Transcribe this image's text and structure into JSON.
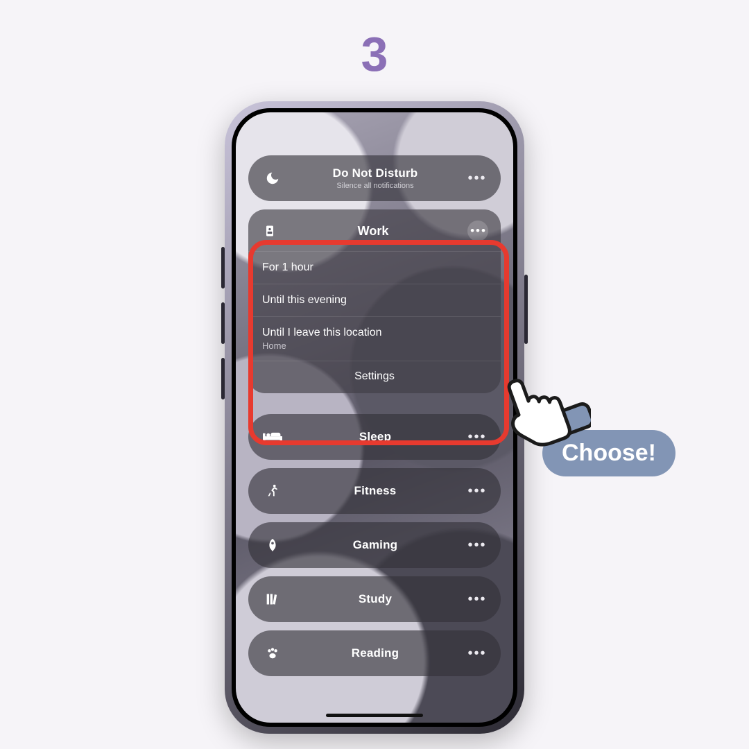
{
  "step_number": "3",
  "callout_label": "Choose!",
  "dnd": {
    "icon": "moon-icon",
    "title": "Do Not Disturb",
    "subtitle": "Silence all notifications",
    "more": "•••"
  },
  "work_card": {
    "icon": "badge-icon",
    "title": "Work",
    "more": "•••",
    "options": [
      {
        "label": "For 1 hour"
      },
      {
        "label": "Until this evening"
      },
      {
        "label": "Until I leave this location",
        "sub": "Home"
      }
    ],
    "settings_label": "Settings"
  },
  "focus_modes": [
    {
      "icon": "bed-icon",
      "label": "Sleep",
      "more": "•••"
    },
    {
      "icon": "running-icon",
      "label": "Fitness",
      "more": "•••"
    },
    {
      "icon": "rocket-icon",
      "label": "Gaming",
      "more": "•••"
    },
    {
      "icon": "books-icon",
      "label": "Study",
      "more": "•••"
    },
    {
      "icon": "paw-icon",
      "label": "Reading",
      "more": "•••"
    }
  ]
}
